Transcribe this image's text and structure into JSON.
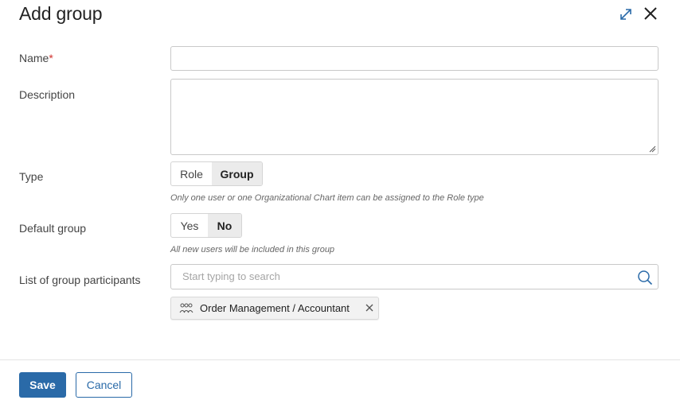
{
  "dialog": {
    "title": "Add group"
  },
  "fields": {
    "name": {
      "label": "Name",
      "required_mark": "*",
      "value": ""
    },
    "description": {
      "label": "Description",
      "value": ""
    },
    "type": {
      "label": "Type",
      "options": [
        "Role",
        "Group"
      ],
      "selected": "Group",
      "hint": "Only one user or one Organizational Chart item can be assigned to the Role type"
    },
    "default_group": {
      "label": "Default group",
      "options": [
        "Yes",
        "No"
      ],
      "selected": "No",
      "hint": "All new users will be included in this group"
    },
    "participants": {
      "label": "List of group participants",
      "placeholder": "Start typing to search",
      "chips": [
        {
          "label": "Order Management / Accountant",
          "icon": "people-group-icon"
        }
      ]
    }
  },
  "footer": {
    "save_label": "Save",
    "cancel_label": "Cancel"
  },
  "colors": {
    "accent": "#2a6aa8",
    "required": "#d0312d"
  }
}
